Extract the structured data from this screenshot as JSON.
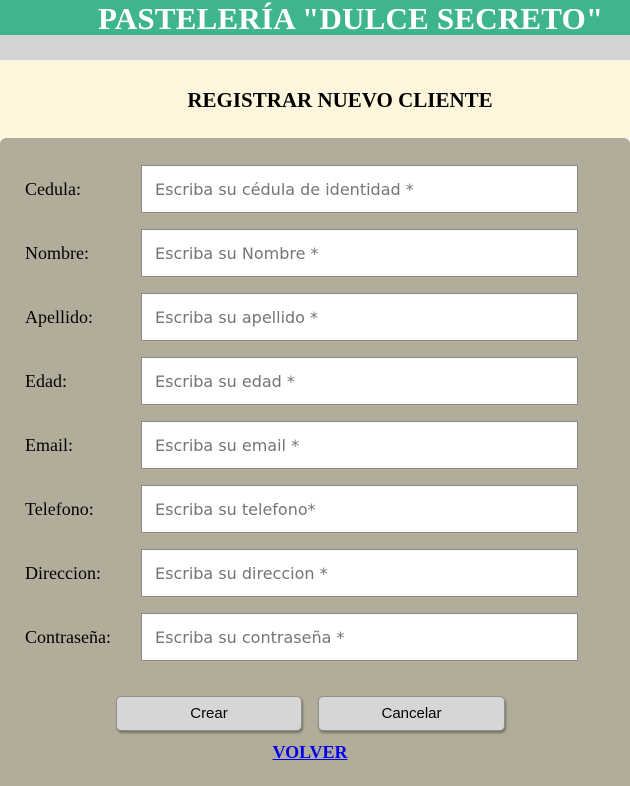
{
  "header": {
    "shop_name": "PASTELERÍA \"DULCE SECRETO\""
  },
  "form": {
    "title": "REGISTRAR NUEVO CLIENTE",
    "fields": [
      {
        "label": "Cedula:",
        "placeholder": "Escriba su cédula de identidad *",
        "value": ""
      },
      {
        "label": "Nombre:",
        "placeholder": "Escriba su Nombre *",
        "value": ""
      },
      {
        "label": "Apellido:",
        "placeholder": "Escriba su apellido *",
        "value": ""
      },
      {
        "label": "Edad:",
        "placeholder": "Escriba su edad *",
        "value": ""
      },
      {
        "label": "Email:",
        "placeholder": "Escriba su email *",
        "value": ""
      },
      {
        "label": "Telefono:",
        "placeholder": "Escriba su telefono*",
        "value": ""
      },
      {
        "label": "Direccion:",
        "placeholder": "Escriba su direccion *",
        "value": ""
      },
      {
        "label": "Contraseña:",
        "placeholder": "Escriba su contraseña *",
        "value": ""
      }
    ],
    "create_label": "Crear",
    "cancel_label": "Cancelar",
    "back_link": "VOLVER"
  },
  "colors": {
    "banner": "#3fb58e",
    "strip": "#d3d3d3",
    "title_band": "#fdf6dc",
    "panel": "#b2ad9b",
    "link": "#0000ee"
  }
}
